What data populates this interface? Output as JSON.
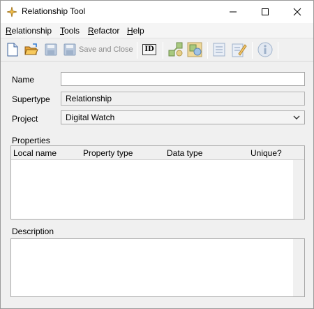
{
  "window": {
    "title": "Relationship Tool",
    "app_icon": "sparkle-star-icon"
  },
  "menubar": {
    "items": [
      {
        "mnemonic": "R",
        "rest": "elationship"
      },
      {
        "mnemonic": "T",
        "rest": "ools"
      },
      {
        "mnemonic": "R",
        "rest": "efactor"
      },
      {
        "mnemonic": "H",
        "rest": "elp"
      }
    ]
  },
  "toolbar": {
    "save_and_close_label": "Save and Close",
    "id_label": "ID"
  },
  "form": {
    "name_label": "Name",
    "name_value": "",
    "supertype_label": "Supertype",
    "supertype_value": "Relationship",
    "project_label": "Project",
    "project_value": "Digital Watch",
    "properties_label": "Properties",
    "columns": [
      "Local name",
      "Property type",
      "Data type",
      "Unique?"
    ],
    "description_label": "Description"
  }
}
